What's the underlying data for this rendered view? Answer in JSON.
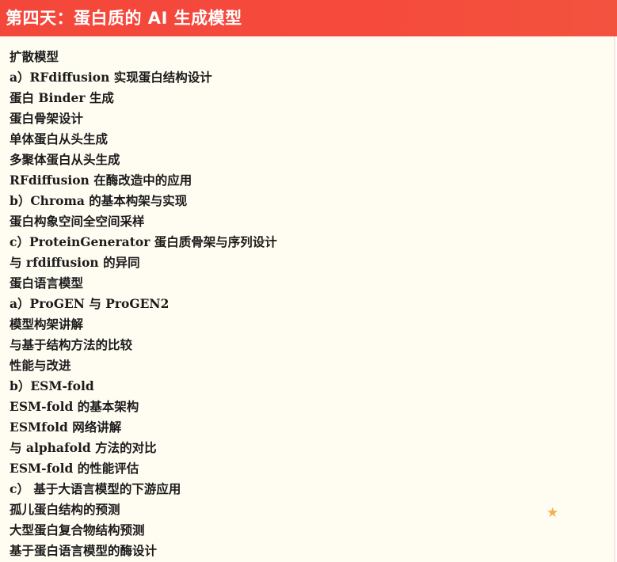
{
  "header": {
    "title": "第四天：蛋白质的 AI 生成模型"
  },
  "lines": [
    "扩散模型",
    "a）RFdiffusion 实现蛋白结构设计",
    "蛋白 Binder 生成",
    "蛋白骨架设计",
    "单体蛋白从头生成",
    "多聚体蛋白从头生成",
    "RFdiffusion 在酶改造中的应用",
    "b）Chroma 的基本构架与实现",
    "蛋白构象空间全空间采样",
    "c）ProteinGenerator 蛋白质骨架与序列设计",
    "与 rfdiffusion 的异同",
    "蛋白语言模型",
    "a）ProGEN 与 ProGEN2",
    "模型构架讲解",
    "与基于结构方法的比较",
    "性能与改进",
    "b）ESM-fold",
    "ESM-fold 的基本架构",
    "ESMfold 网络讲解",
    "与 alphafold 方法的对比",
    "ESM-fold 的性能评估",
    "c） 基于大语言模型的下游应用",
    "孤儿蛋白结构的预测",
    "大型蛋白复合物结构预测",
    "基于蛋白语言模型的酶设计"
  ],
  "decoration": {
    "star_icon": "star-icon",
    "star_color": "#f2b24a"
  }
}
